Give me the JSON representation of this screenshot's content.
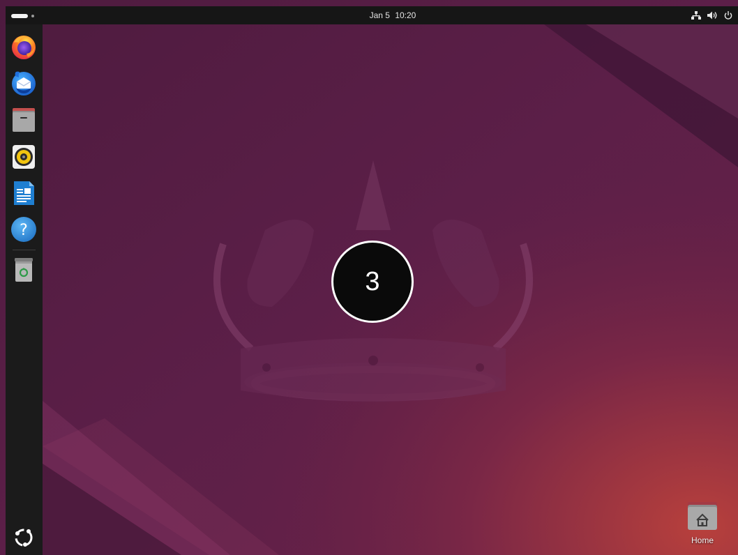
{
  "topbar": {
    "date": "Jan 5",
    "time": "10:20",
    "activities_icon": "activities-indicator-icon",
    "tray_icons": [
      "network-icon",
      "volume-icon",
      "power-icon"
    ]
  },
  "dock": {
    "items": [
      {
        "name": "firefox",
        "icon": "firefox-icon",
        "running": false
      },
      {
        "name": "thunderbird",
        "icon": "thunderbird-icon",
        "running": false
      },
      {
        "name": "files",
        "icon": "files-icon",
        "running": false
      },
      {
        "name": "rhythmbox",
        "icon": "rhythmbox-icon",
        "running": false
      },
      {
        "name": "libreoffice-writer",
        "icon": "libreoffice-writer-icon",
        "running": false
      },
      {
        "name": "help",
        "icon": "help-icon",
        "running": false
      },
      {
        "name": "trash",
        "icon": "trash-icon",
        "running": false
      }
    ],
    "app_grid_icon": "show-apps-icon"
  },
  "countdown": {
    "value": "3"
  },
  "desktop": {
    "icons": [
      {
        "label": "Home",
        "icon": "home-folder-icon"
      }
    ]
  },
  "colors": {
    "wallpaper_base": "#5c1f48",
    "wallpaper_accent": "#c0453a",
    "topbar": "#161616",
    "dock": "#1b1b1b",
    "countdown_bg": "#0a0a0a",
    "countdown_ring": "#ffffff"
  }
}
